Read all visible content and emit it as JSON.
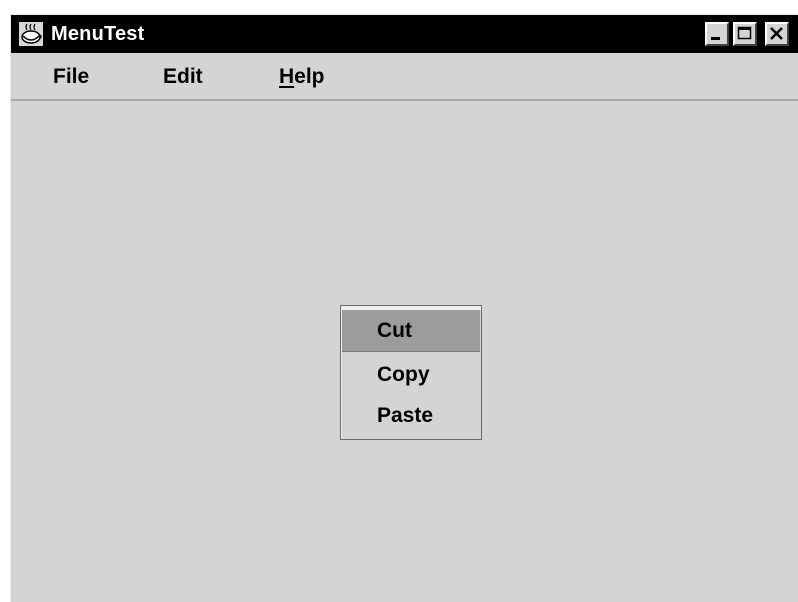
{
  "window": {
    "title": "MenuTest",
    "buttons": {
      "minimize": "minimize-icon",
      "maximize": "maximize-icon",
      "close": "close-icon"
    }
  },
  "menubar": {
    "items": [
      {
        "label": "File"
      },
      {
        "label": "Edit"
      },
      {
        "label_mnemonic": "H",
        "label_rest": "elp",
        "label": "Help"
      }
    ]
  },
  "popup_menu": {
    "items": [
      {
        "label": "Cut",
        "highlighted": true
      },
      {
        "label": "Copy",
        "highlighted": false
      },
      {
        "label": "Paste",
        "highlighted": false
      }
    ]
  },
  "colors": {
    "titlebar": "#000000",
    "background": "#d4d4d4",
    "highlight": "#9c9c9c"
  }
}
